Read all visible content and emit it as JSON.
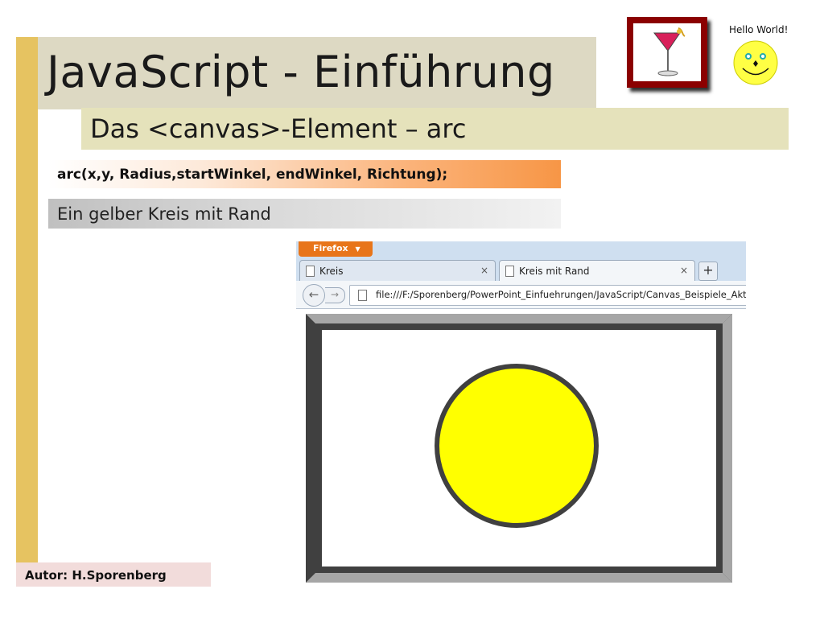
{
  "slide": {
    "title": "JavaScript - Einführung",
    "subtitle": "Das <canvas>-Element – arc",
    "code": "arc(x,y, Radius,startWinkel, endWinkel, Richtung);",
    "description": "Ein gelber Kreis mit Rand",
    "author": "Autor: H.Sporenberg"
  },
  "decor": {
    "hello_text": "Hello World!",
    "cocktail_icon": "cocktail-glass-icon",
    "smiley_icon": "smiley-face-icon"
  },
  "browser": {
    "app_button": "Firefox",
    "tabs": [
      {
        "label": "Kreis",
        "active": false
      },
      {
        "label": "Kreis mit Rand",
        "active": true
      }
    ],
    "new_tab_label": "+",
    "close_glyph": "×",
    "url": "file:///F:/Sporenberg/PowerPoint_Einfuehrungen/JavaScript/Canvas_Beispiele_Aktuell/Kr"
  },
  "colors": {
    "accent_bar": "#e6c361",
    "title_band": "#ddd9c3",
    "subtitle_band": "#e5e2bb",
    "code_orange": "#f79646",
    "circle_fill": "#ffff00",
    "circle_stroke": "#404040",
    "frame_outer": "#404040",
    "frame_inner": "#a6a6a6"
  }
}
